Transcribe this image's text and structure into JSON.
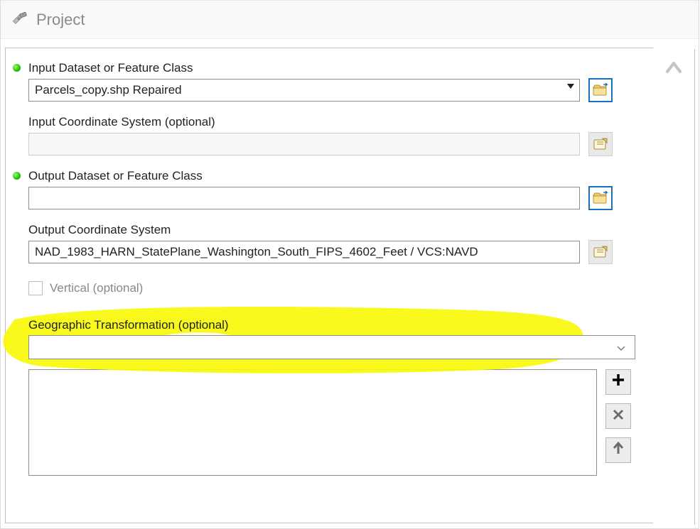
{
  "window": {
    "title": "Project"
  },
  "params": {
    "input_dataset": {
      "label": "Input Dataset or Feature Class",
      "value": "Parcels_copy.shp Repaired"
    },
    "input_cs": {
      "label": "Input Coordinate System (optional)",
      "value": ""
    },
    "output_dataset": {
      "label": "Output Dataset or Feature Class",
      "value": ""
    },
    "output_cs": {
      "label": "Output Coordinate System",
      "value": "NAD_1983_HARN_StatePlane_Washington_South_FIPS_4602_Feet / VCS:NAVD"
    },
    "vertical": {
      "label": "Vertical (optional)",
      "checked": false
    },
    "geo_transform": {
      "label": "Geographic Transformation (optional)",
      "value": ""
    }
  },
  "icons": {
    "browse": "folder-open-icon",
    "props": "coordinate-system-icon"
  },
  "list_buttons": {
    "add": "+",
    "remove": "×",
    "up": "↑"
  }
}
